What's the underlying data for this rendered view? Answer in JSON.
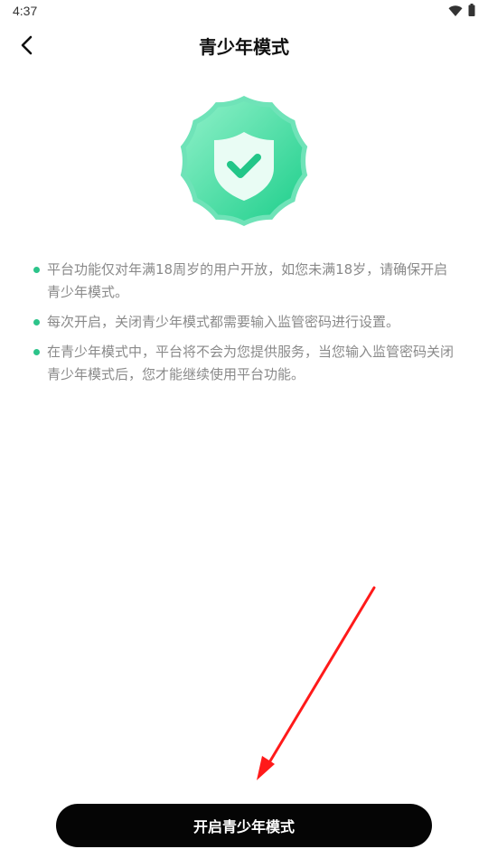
{
  "status_bar": {
    "time": "4:37",
    "wifi_icon": "wifi-icon",
    "battery_icon": "battery-icon"
  },
  "nav": {
    "back_icon": "chevron-left-icon",
    "title": "青少年模式"
  },
  "badge": {
    "icon": "shield-check-icon",
    "colors": {
      "outer": "#6fe3b8",
      "inner": "#1fcf8c",
      "shield": "#e8fbf3",
      "check": "#25c98a"
    }
  },
  "rules": [
    "平台功能仅对年满18周岁的用户开放，如您未满18岁，请确保开启青少年模式。",
    "每次开启，关闭青少年模式都需要输入监管密码进行设置。",
    "在青少年模式中，平台将不会为您提供服务，当您输入监管密码关闭青少年模式后，您才能继续使用平台功能。"
  ],
  "accent_color": "#2cc48a",
  "primary_button": {
    "label": "开启青少年模式",
    "background": "#050505"
  },
  "annotation": {
    "icon": "red-arrow-icon",
    "color": "#ff1a1a"
  }
}
